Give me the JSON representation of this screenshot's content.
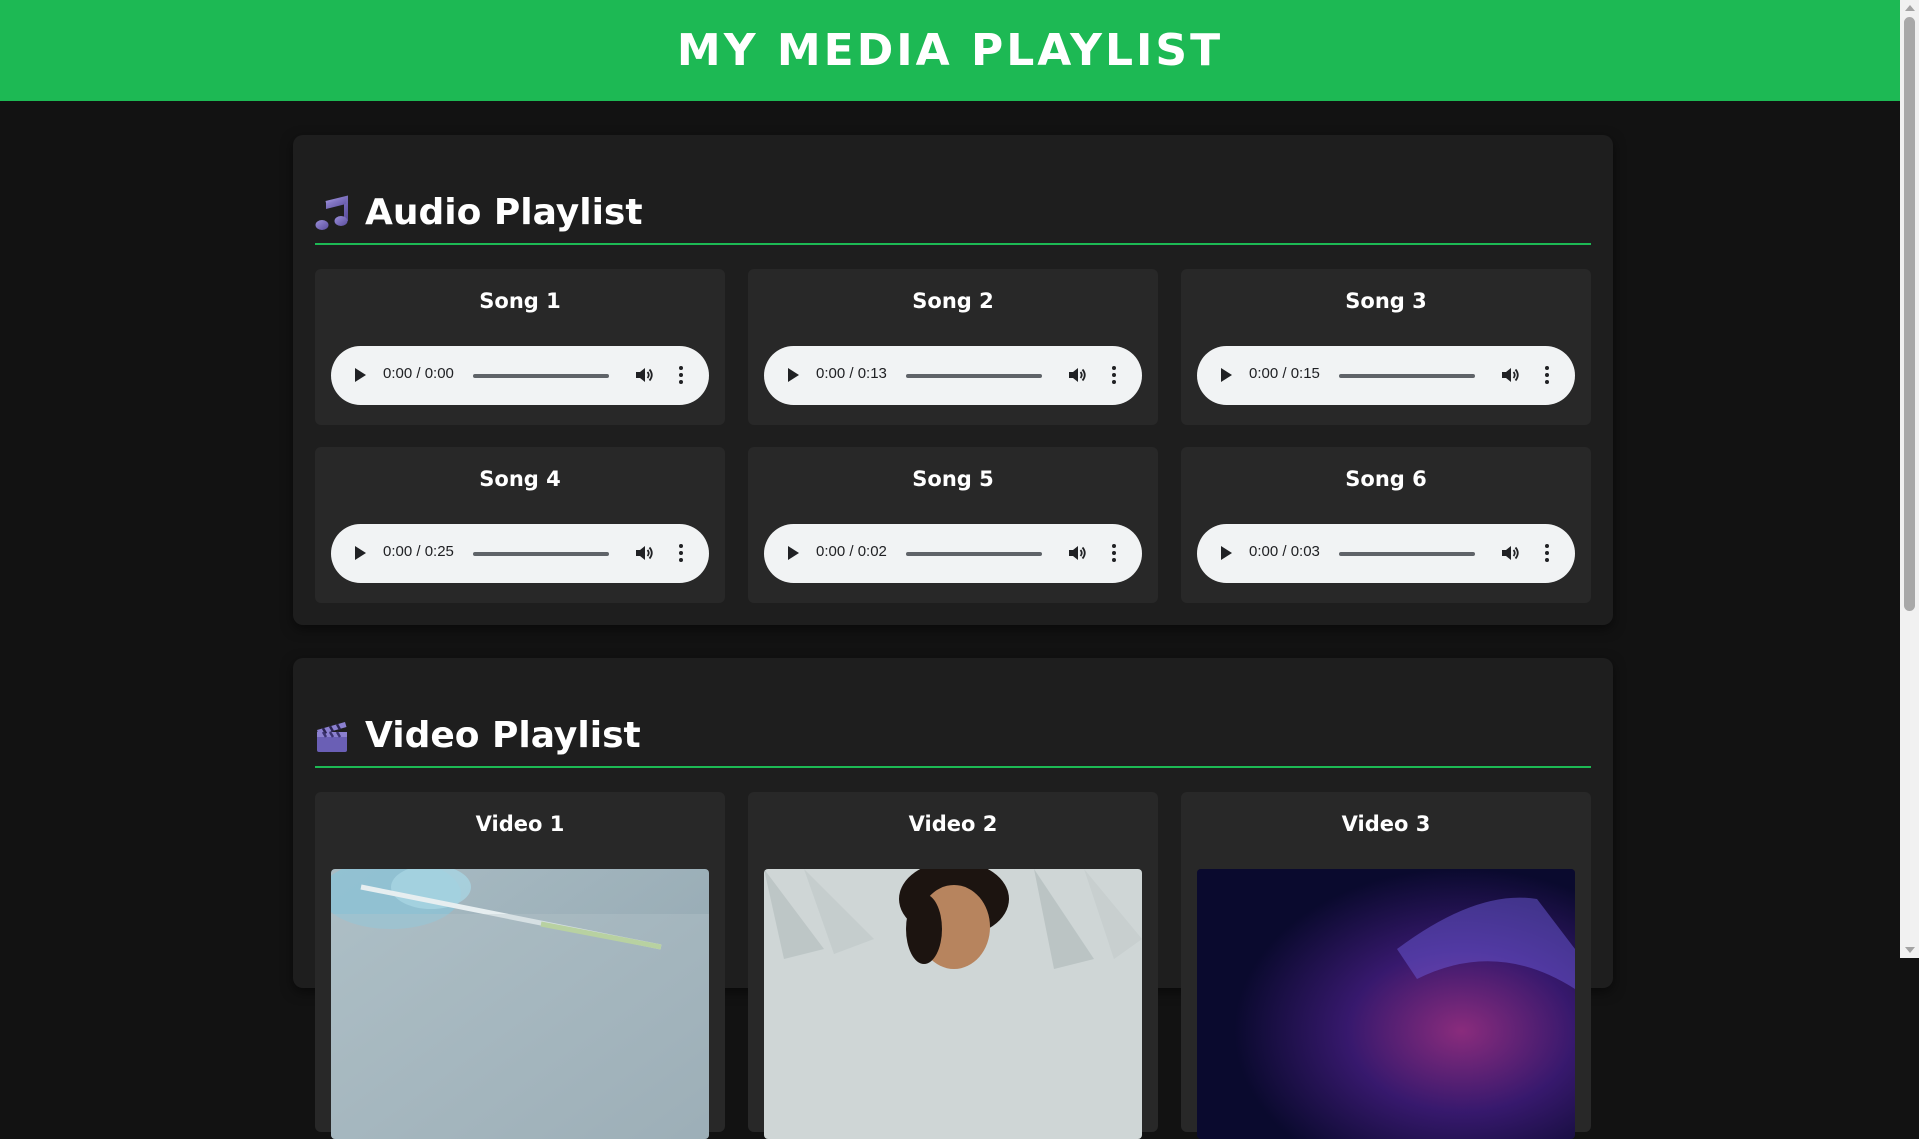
{
  "header": {
    "title": "MY MEDIA PLAYLIST",
    "background": "#1db954"
  },
  "audio": {
    "title": "Audio Playlist",
    "icon": "music-note-icon",
    "items": [
      {
        "title": "Song 1",
        "time": "0:00 / 0:00"
      },
      {
        "title": "Song 2",
        "time": "0:00 / 0:13"
      },
      {
        "title": "Song 3",
        "time": "0:00 / 0:15"
      },
      {
        "title": "Song 4",
        "time": "0:00 / 0:25"
      },
      {
        "title": "Song 5",
        "time": "0:00 / 0:02"
      },
      {
        "title": "Song 6",
        "time": "0:00 / 0:03"
      }
    ]
  },
  "video": {
    "title": "Video Playlist",
    "icon": "clapper-board-icon",
    "items": [
      {
        "title": "Video 1"
      },
      {
        "title": "Video 2"
      },
      {
        "title": "Video 3"
      }
    ]
  },
  "colors": {
    "accent": "#1db954",
    "page_bg": "#121212",
    "section_bg": "#1e1e1e",
    "card_bg": "#282828"
  }
}
